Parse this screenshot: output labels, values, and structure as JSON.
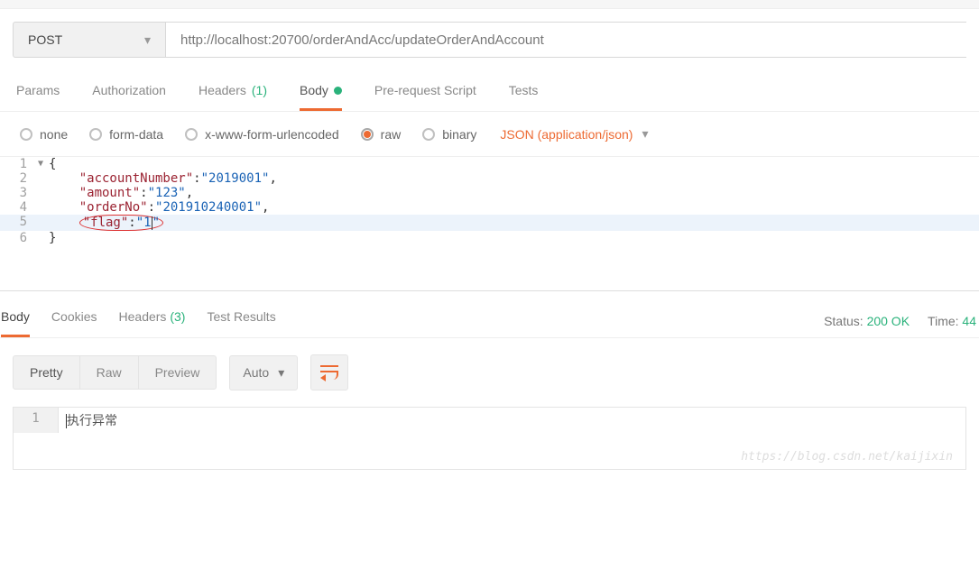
{
  "request": {
    "method": "POST",
    "url": "http://localhost:20700/orderAndAcc/updateOrderAndAccount"
  },
  "tabs": {
    "params": "Params",
    "authorization": "Authorization",
    "headers": "Headers",
    "headers_count": "(1)",
    "body": "Body",
    "prerequest": "Pre-request Script",
    "tests": "Tests"
  },
  "body_types": {
    "none": "none",
    "formdata": "form-data",
    "urlencoded": "x-www-form-urlencoded",
    "raw": "raw",
    "binary": "binary"
  },
  "content_type": "JSON (application/json)",
  "editor": {
    "lines": [
      "1",
      "2",
      "3",
      "4",
      "5",
      "6"
    ],
    "brace_open": "{",
    "brace_close": "}",
    "k_account": "\"accountNumber\"",
    "v_account": "\"2019001\"",
    "k_amount": "\"amount\"",
    "v_amount": "\"123\"",
    "k_orderno": "\"orderNo\"",
    "v_orderno": "\"201910240001\"",
    "k_flag": "\"flag\"",
    "v_flag_open": "\"",
    "v_flag_val": "1",
    "v_flag_close": "\""
  },
  "response": {
    "tabs": {
      "body": "Body",
      "cookies": "Cookies",
      "headers": "Headers",
      "headers_count": "(3)",
      "test_results": "Test Results"
    },
    "status_label": "Status:",
    "status_value": "200 OK",
    "time_label": "Time:",
    "time_value": "44",
    "view": {
      "pretty": "Pretty",
      "raw": "Raw",
      "preview": "Preview",
      "auto": "Auto"
    },
    "line_no": "1",
    "text": "执行异常"
  },
  "watermark": "https://blog.csdn.net/kaijixin"
}
